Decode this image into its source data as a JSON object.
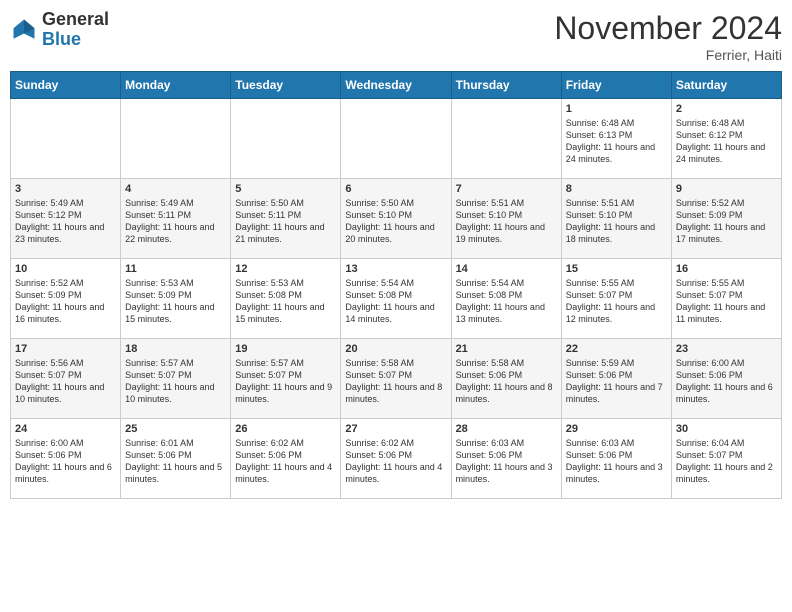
{
  "header": {
    "logo_general": "General",
    "logo_blue": "Blue",
    "month_title": "November 2024",
    "location": "Ferrier, Haiti"
  },
  "days_of_week": [
    "Sunday",
    "Monday",
    "Tuesday",
    "Wednesday",
    "Thursday",
    "Friday",
    "Saturday"
  ],
  "weeks": [
    [
      {
        "day": "",
        "info": ""
      },
      {
        "day": "",
        "info": ""
      },
      {
        "day": "",
        "info": ""
      },
      {
        "day": "",
        "info": ""
      },
      {
        "day": "",
        "info": ""
      },
      {
        "day": "1",
        "info": "Sunrise: 6:48 AM\nSunset: 6:13 PM\nDaylight: 11 hours and 24 minutes."
      },
      {
        "day": "2",
        "info": "Sunrise: 6:48 AM\nSunset: 6:12 PM\nDaylight: 11 hours and 24 minutes."
      }
    ],
    [
      {
        "day": "3",
        "info": "Sunrise: 5:49 AM\nSunset: 5:12 PM\nDaylight: 11 hours and 23 minutes."
      },
      {
        "day": "4",
        "info": "Sunrise: 5:49 AM\nSunset: 5:11 PM\nDaylight: 11 hours and 22 minutes."
      },
      {
        "day": "5",
        "info": "Sunrise: 5:50 AM\nSunset: 5:11 PM\nDaylight: 11 hours and 21 minutes."
      },
      {
        "day": "6",
        "info": "Sunrise: 5:50 AM\nSunset: 5:10 PM\nDaylight: 11 hours and 20 minutes."
      },
      {
        "day": "7",
        "info": "Sunrise: 5:51 AM\nSunset: 5:10 PM\nDaylight: 11 hours and 19 minutes."
      },
      {
        "day": "8",
        "info": "Sunrise: 5:51 AM\nSunset: 5:10 PM\nDaylight: 11 hours and 18 minutes."
      },
      {
        "day": "9",
        "info": "Sunrise: 5:52 AM\nSunset: 5:09 PM\nDaylight: 11 hours and 17 minutes."
      }
    ],
    [
      {
        "day": "10",
        "info": "Sunrise: 5:52 AM\nSunset: 5:09 PM\nDaylight: 11 hours and 16 minutes."
      },
      {
        "day": "11",
        "info": "Sunrise: 5:53 AM\nSunset: 5:09 PM\nDaylight: 11 hours and 15 minutes."
      },
      {
        "day": "12",
        "info": "Sunrise: 5:53 AM\nSunset: 5:08 PM\nDaylight: 11 hours and 15 minutes."
      },
      {
        "day": "13",
        "info": "Sunrise: 5:54 AM\nSunset: 5:08 PM\nDaylight: 11 hours and 14 minutes."
      },
      {
        "day": "14",
        "info": "Sunrise: 5:54 AM\nSunset: 5:08 PM\nDaylight: 11 hours and 13 minutes."
      },
      {
        "day": "15",
        "info": "Sunrise: 5:55 AM\nSunset: 5:07 PM\nDaylight: 11 hours and 12 minutes."
      },
      {
        "day": "16",
        "info": "Sunrise: 5:55 AM\nSunset: 5:07 PM\nDaylight: 11 hours and 11 minutes."
      }
    ],
    [
      {
        "day": "17",
        "info": "Sunrise: 5:56 AM\nSunset: 5:07 PM\nDaylight: 11 hours and 10 minutes."
      },
      {
        "day": "18",
        "info": "Sunrise: 5:57 AM\nSunset: 5:07 PM\nDaylight: 11 hours and 10 minutes."
      },
      {
        "day": "19",
        "info": "Sunrise: 5:57 AM\nSunset: 5:07 PM\nDaylight: 11 hours and 9 minutes."
      },
      {
        "day": "20",
        "info": "Sunrise: 5:58 AM\nSunset: 5:07 PM\nDaylight: 11 hours and 8 minutes."
      },
      {
        "day": "21",
        "info": "Sunrise: 5:58 AM\nSunset: 5:06 PM\nDaylight: 11 hours and 8 minutes."
      },
      {
        "day": "22",
        "info": "Sunrise: 5:59 AM\nSunset: 5:06 PM\nDaylight: 11 hours and 7 minutes."
      },
      {
        "day": "23",
        "info": "Sunrise: 6:00 AM\nSunset: 5:06 PM\nDaylight: 11 hours and 6 minutes."
      }
    ],
    [
      {
        "day": "24",
        "info": "Sunrise: 6:00 AM\nSunset: 5:06 PM\nDaylight: 11 hours and 6 minutes."
      },
      {
        "day": "25",
        "info": "Sunrise: 6:01 AM\nSunset: 5:06 PM\nDaylight: 11 hours and 5 minutes."
      },
      {
        "day": "26",
        "info": "Sunrise: 6:02 AM\nSunset: 5:06 PM\nDaylight: 11 hours and 4 minutes."
      },
      {
        "day": "27",
        "info": "Sunrise: 6:02 AM\nSunset: 5:06 PM\nDaylight: 11 hours and 4 minutes."
      },
      {
        "day": "28",
        "info": "Sunrise: 6:03 AM\nSunset: 5:06 PM\nDaylight: 11 hours and 3 minutes."
      },
      {
        "day": "29",
        "info": "Sunrise: 6:03 AM\nSunset: 5:06 PM\nDaylight: 11 hours and 3 minutes."
      },
      {
        "day": "30",
        "info": "Sunrise: 6:04 AM\nSunset: 5:07 PM\nDaylight: 11 hours and 2 minutes."
      }
    ]
  ]
}
